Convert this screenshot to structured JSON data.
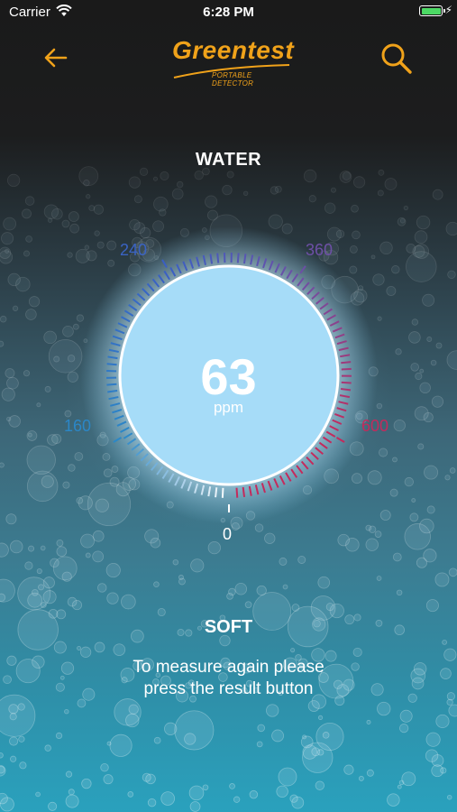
{
  "status_bar": {
    "carrier": "Carrier",
    "time": "6:28 PM"
  },
  "header": {
    "brand_name": "Greentest",
    "brand_tagline": "PORTABLE DETECTOR",
    "back_icon": "arrow-left-icon",
    "search_icon": "search-icon"
  },
  "page_title": "WATER",
  "gauge": {
    "value": "63",
    "unit": "ppm",
    "reading_value": 63,
    "scale_labels": {
      "low": "160",
      "mid_low": "240",
      "mid_high": "360",
      "high": "600",
      "zero": "0"
    }
  },
  "result": {
    "label": "SOFT",
    "hint_line1": "To measure again please",
    "hint_line2": "press the result button"
  },
  "colors": {
    "brand": "#f0a21a",
    "dial_fill": "#a6dcf8",
    "scale_blue": "#2b87c7",
    "scale_purple": "#6d4fa6",
    "scale_red": "#c42a5c"
  }
}
